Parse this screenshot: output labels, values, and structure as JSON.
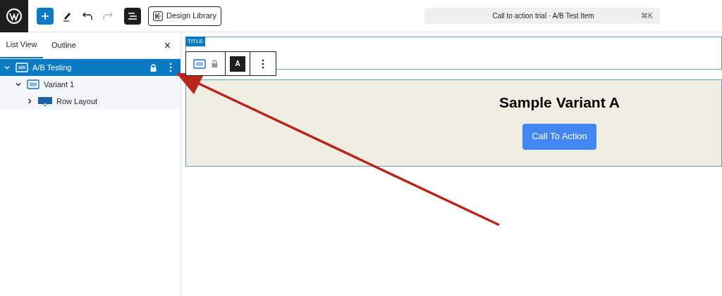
{
  "toolbar": {
    "design_library": "Design Library",
    "command": {
      "title": "Call to action trial · A/B Test Item",
      "shortcut": "⌘K"
    }
  },
  "sidebar": {
    "tabs": [
      {
        "label": "List View",
        "selected": true
      },
      {
        "label": "Outline",
        "selected": false
      }
    ],
    "close": "×",
    "tree": [
      {
        "label": "A/B Testing",
        "kind": "ab",
        "selected": true,
        "expanded": true,
        "locked": true,
        "children": [
          {
            "label": "Variant 1",
            "kind": "ab",
            "selected": false,
            "expanded": true,
            "locked": false,
            "children": [
              {
                "label": "Row Layout",
                "kind": "row",
                "selected": false,
                "expanded": false,
                "locked": false
              }
            ]
          }
        ]
      }
    ]
  },
  "canvas": {
    "title_badge": "TITLE",
    "block_toolbar": {
      "locked": true,
      "avatar": "A"
    },
    "variant": {
      "heading": "Sample Variant A",
      "button": "Call To Action"
    }
  }
}
